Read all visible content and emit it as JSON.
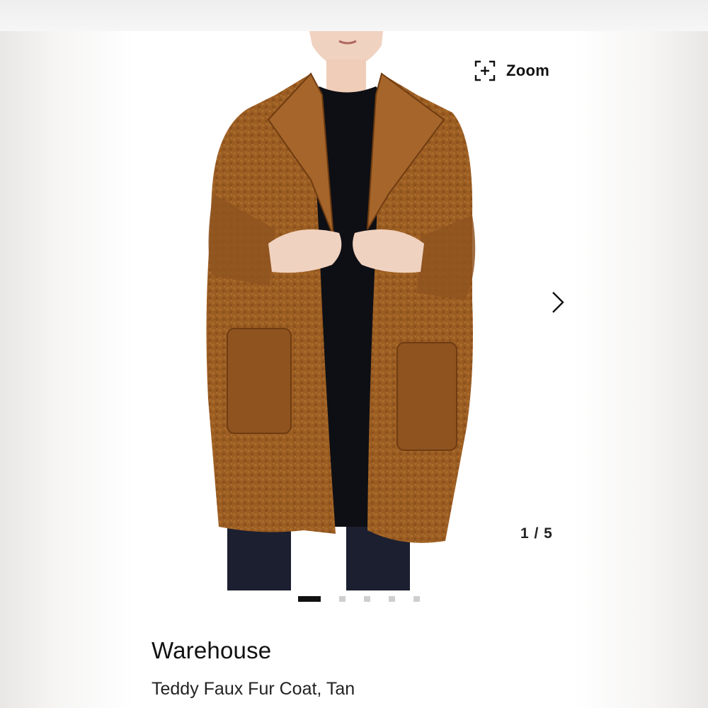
{
  "gallery": {
    "zoom_label": "Zoom",
    "counter": "1 / 5",
    "current_index": 1,
    "total_images": 5
  },
  "product": {
    "brand": "Warehouse",
    "name": "Teddy Faux Fur Coat, Tan"
  },
  "colors": {
    "coat": "#9c5d22",
    "coat_dark": "#7a4416",
    "top": "#0e0f14",
    "trousers": "#1b1f30",
    "skin": "#f0d2c0",
    "active_dot": "#111111",
    "inactive_dot": "#cfcfcf"
  },
  "icons": {
    "zoom": "zoom-expand-icon",
    "next": "chevron-right-icon"
  }
}
